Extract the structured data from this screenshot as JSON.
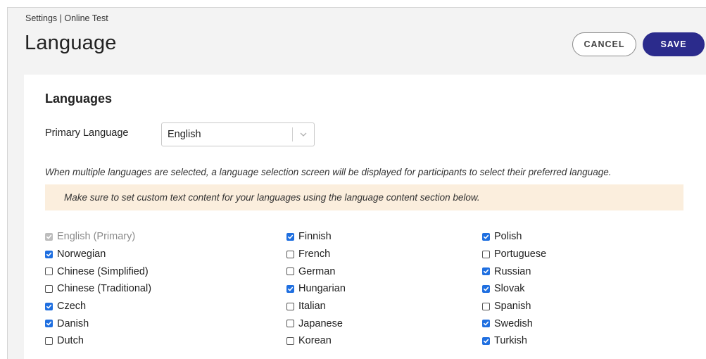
{
  "header": {
    "breadcrumb": "Settings | Online Test",
    "title": "Language",
    "cancel_label": "CANCEL",
    "save_label": "SAVE"
  },
  "languages_section": {
    "heading": "Languages",
    "primary_label": "Primary Language",
    "primary_value": "English",
    "hint": "When multiple languages are selected, a language selection screen will be displayed for participants to select their preferred language.",
    "notice": "Make sure to set custom text content for your languages using the language content section below."
  },
  "language_options": {
    "col1": [
      {
        "label": "English (Primary)",
        "checked": true,
        "disabled": true
      },
      {
        "label": "Norwegian",
        "checked": true,
        "disabled": false
      },
      {
        "label": "Chinese (Simplified)",
        "checked": false,
        "disabled": false
      },
      {
        "label": "Chinese (Traditional)",
        "checked": false,
        "disabled": false
      },
      {
        "label": "Czech",
        "checked": true,
        "disabled": false
      },
      {
        "label": "Danish",
        "checked": true,
        "disabled": false
      },
      {
        "label": "Dutch",
        "checked": false,
        "disabled": false
      }
    ],
    "col2": [
      {
        "label": "Finnish",
        "checked": true,
        "disabled": false
      },
      {
        "label": "French",
        "checked": false,
        "disabled": false
      },
      {
        "label": "German",
        "checked": false,
        "disabled": false
      },
      {
        "label": "Hungarian",
        "checked": true,
        "disabled": false
      },
      {
        "label": "Italian",
        "checked": false,
        "disabled": false
      },
      {
        "label": "Japanese",
        "checked": false,
        "disabled": false
      },
      {
        "label": "Korean",
        "checked": false,
        "disabled": false
      }
    ],
    "col3": [
      {
        "label": "Polish",
        "checked": true,
        "disabled": false
      },
      {
        "label": "Portuguese",
        "checked": false,
        "disabled": false
      },
      {
        "label": "Russian",
        "checked": true,
        "disabled": false
      },
      {
        "label": "Slovak",
        "checked": true,
        "disabled": false
      },
      {
        "label": "Spanish",
        "checked": false,
        "disabled": false
      },
      {
        "label": "Swedish",
        "checked": true,
        "disabled": false
      },
      {
        "label": "Turkish",
        "checked": true,
        "disabled": false
      }
    ]
  },
  "colors": {
    "save_button": "#2b2b8c",
    "checkbox_checked": "#1f6fe0",
    "notice_background": "#fbeedd"
  }
}
